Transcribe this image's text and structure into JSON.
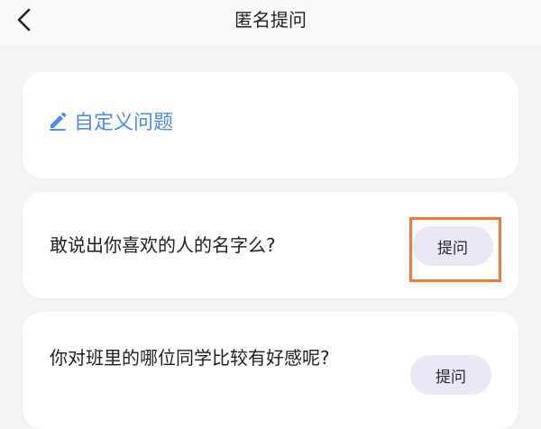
{
  "header": {
    "title": "匿名提问",
    "back_icon": "chevron-left-icon"
  },
  "custom_question": {
    "label": "自定义问题",
    "icon": "pencil-icon",
    "color": "#4a8ee8"
  },
  "questions": [
    {
      "text": "敢说出你喜欢的人的名字么?",
      "button_label": "提问",
      "highlighted": true
    },
    {
      "text": "你对班里的哪位同学比较有好感呢?",
      "button_label": "提问",
      "highlighted": false
    }
  ],
  "colors": {
    "background": "#f4f4f7",
    "card": "#ffffff",
    "button_bg": "#e8e9f5",
    "highlight": "#f07a3a"
  }
}
